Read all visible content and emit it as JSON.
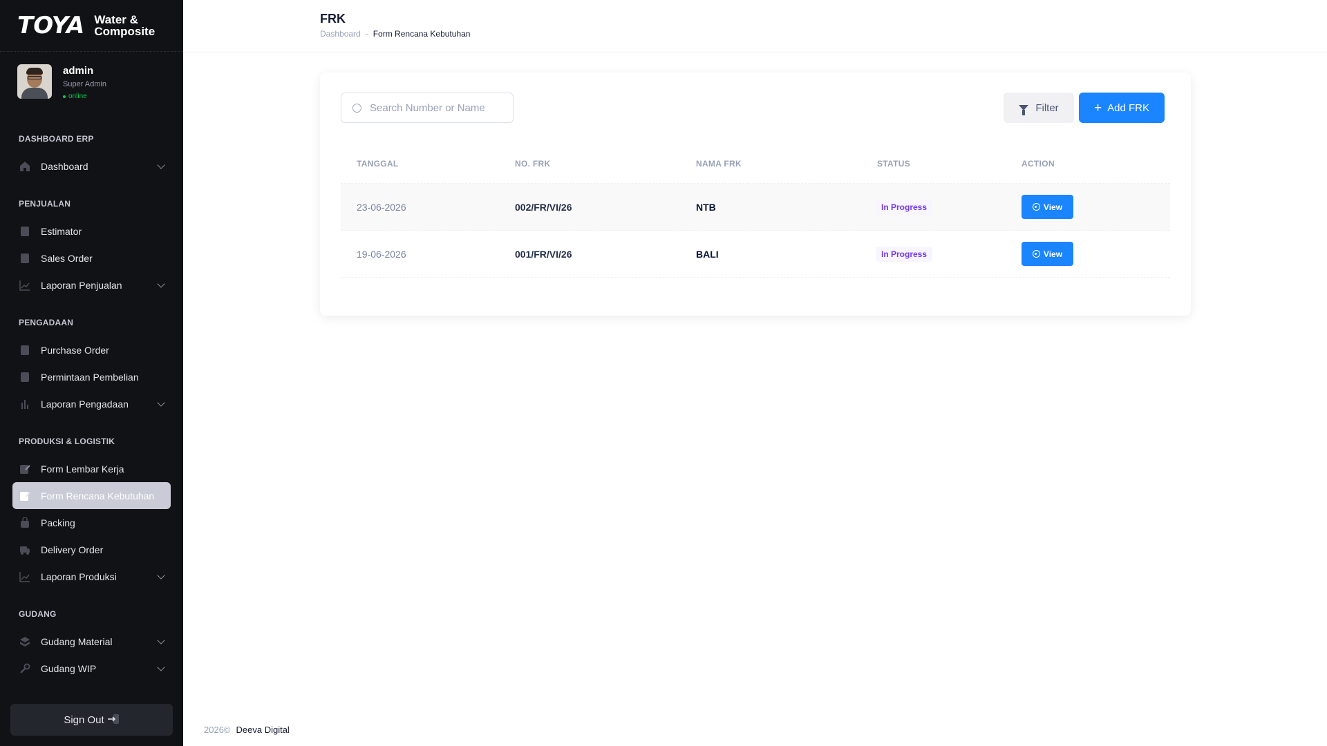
{
  "brand": {
    "logo": "TOYA",
    "subtitle_line1": "Water &",
    "subtitle_line2": "Composite"
  },
  "user": {
    "name": "admin",
    "role": "Super Admin",
    "status": "online"
  },
  "sidebar": {
    "sections": [
      {
        "title": "DASHBOARD ERP",
        "items": [
          {
            "label": "Dashboard",
            "icon": "home-icon",
            "expandable": true
          }
        ]
      },
      {
        "title": "PENJUALAN",
        "items": [
          {
            "label": "Estimator",
            "icon": "document-icon",
            "expandable": false
          },
          {
            "label": "Sales Order",
            "icon": "document-icon",
            "expandable": false
          },
          {
            "label": "Laporan Penjualan",
            "icon": "chart-line-icon",
            "expandable": true
          }
        ]
      },
      {
        "title": "PENGADAAN",
        "items": [
          {
            "label": "Purchase Order",
            "icon": "document-icon",
            "expandable": false
          },
          {
            "label": "Permintaan Pembelian",
            "icon": "document-icon",
            "expandable": false
          },
          {
            "label": "Laporan Pengadaan",
            "icon": "chart-bar-icon",
            "expandable": true
          }
        ]
      },
      {
        "title": "PRODUKSI & LOGISTIK",
        "items": [
          {
            "label": "Form Lembar Kerja",
            "icon": "edit-icon",
            "expandable": false
          },
          {
            "label": "Form Rencana Kebutuhan",
            "icon": "edit-icon",
            "expandable": false,
            "active": true
          },
          {
            "label": "Packing",
            "icon": "package-icon",
            "expandable": false
          },
          {
            "label": "Delivery Order",
            "icon": "truck-icon",
            "expandable": false
          },
          {
            "label": "Laporan Produksi",
            "icon": "chart-line-icon",
            "expandable": true
          }
        ]
      },
      {
        "title": "GUDANG",
        "items": [
          {
            "label": "Gudang Material",
            "icon": "layers-icon",
            "expandable": true
          },
          {
            "label": "Gudang WIP",
            "icon": "wrench-icon",
            "expandable": true
          }
        ]
      }
    ],
    "signout_label": "Sign Out"
  },
  "header": {
    "title": "FRK",
    "breadcrumb_home": "Dashboard",
    "breadcrumb_current": "Form Rencana Kebutuhan"
  },
  "toolbar": {
    "search_placeholder": "Search Number or Name",
    "filter_label": "Filter",
    "add_label": "Add FRK"
  },
  "table": {
    "columns": [
      "TANGGAL",
      "NO. FRK",
      "NAMA FRK",
      "STATUS",
      "ACTION"
    ],
    "rows": [
      {
        "tanggal": "23-06-2026",
        "no": "002/FR/VI/26",
        "nama": "NTB",
        "status": "In Progress",
        "action": "View"
      },
      {
        "tanggal": "19-06-2026",
        "no": "001/FR/VI/26",
        "nama": "BALI",
        "status": "In Progress",
        "action": "View"
      }
    ]
  },
  "footer": {
    "year": "2026©",
    "company": "Deeva Digital"
  },
  "colors": {
    "primary": "#1b84ff",
    "sidebar_bg": "#111216",
    "status_purple": "#7239ea",
    "online_green": "#17c653"
  }
}
